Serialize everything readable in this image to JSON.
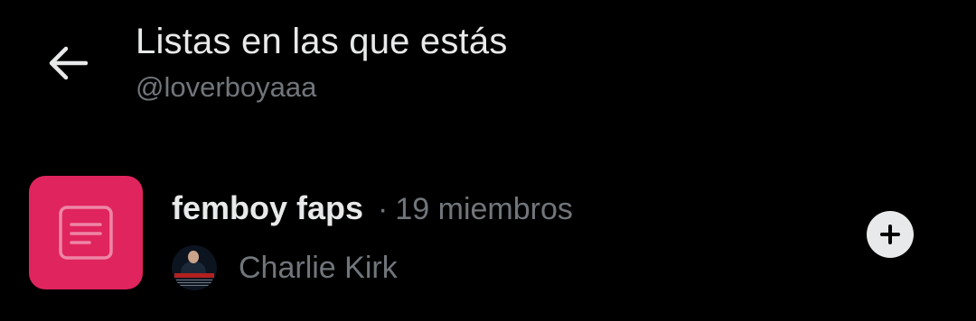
{
  "header": {
    "back_icon": "arrow-left-icon",
    "title": "Listas en las que estás",
    "subtitle": "@loverboyaaa"
  },
  "lists": [
    {
      "icon": "list-document-icon",
      "icon_bg_color": "#e0245e",
      "name": "femboy faps",
      "separator": "·",
      "members": "19 miembros",
      "owner_name": "Charlie Kirk",
      "action_icon": "plus-icon"
    }
  ],
  "colors": {
    "background": "#000000",
    "primary_text": "#e7e9ea",
    "secondary_text": "#71767b",
    "list_accent": "#e0245e"
  }
}
